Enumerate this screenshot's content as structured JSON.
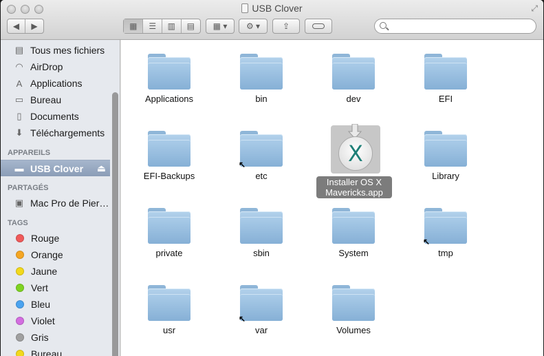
{
  "window": {
    "title": "USB Clover"
  },
  "toolbar": {
    "back_icon": "chevron-left-icon",
    "forward_icon": "chevron-right-icon",
    "view_modes": [
      "icon-view-icon",
      "list-view-icon",
      "column-view-icon",
      "coverflow-view-icon"
    ],
    "arrange_icon": "arrange-icon",
    "action_icon": "gear-icon",
    "share_icon": "share-icon",
    "tags_icon": "tag-icon",
    "search_placeholder": ""
  },
  "sidebar": {
    "favorites": [
      {
        "label": "Tous mes fichiers",
        "icon": "all-files-icon"
      },
      {
        "label": "AirDrop",
        "icon": "airdrop-icon"
      },
      {
        "label": "Applications",
        "icon": "applications-icon"
      },
      {
        "label": "Bureau",
        "icon": "desktop-icon"
      },
      {
        "label": "Documents",
        "icon": "documents-icon"
      },
      {
        "label": "Téléchargements",
        "icon": "downloads-icon"
      }
    ],
    "devices_header": "APPAREILS",
    "devices": [
      {
        "label": "USB Clover",
        "icon": "drive-icon",
        "eject": "⏏"
      }
    ],
    "shared_header": "PARTAGÉS",
    "shared": [
      {
        "label": "Mac Pro de Pier…",
        "icon": "computer-icon"
      }
    ],
    "tags_header": "TAGS",
    "tags": [
      {
        "label": "Rouge",
        "color": "#f05a5a"
      },
      {
        "label": "Orange",
        "color": "#f5a623"
      },
      {
        "label": "Jaune",
        "color": "#f2d91c"
      },
      {
        "label": "Vert",
        "color": "#7ed321"
      },
      {
        "label": "Bleu",
        "color": "#4aa3f0"
      },
      {
        "label": "Violet",
        "color": "#d36ee0"
      },
      {
        "label": "Gris",
        "color": "#a0a0a0"
      },
      {
        "label": "Bureau",
        "color": "#f2d91c"
      }
    ]
  },
  "files": [
    {
      "name": "Applications",
      "kind": "folder",
      "alias": false
    },
    {
      "name": "bin",
      "kind": "folder",
      "alias": false
    },
    {
      "name": "dev",
      "kind": "folder",
      "alias": false
    },
    {
      "name": "EFI",
      "kind": "folder",
      "alias": false
    },
    {
      "name": "EFI-Backups",
      "kind": "folder",
      "alias": false
    },
    {
      "name": "etc",
      "kind": "folder",
      "alias": true
    },
    {
      "name": "Installer OS X Mavericks.app",
      "kind": "app",
      "alias": false
    },
    {
      "name": "Library",
      "kind": "folder",
      "alias": false
    },
    {
      "name": "private",
      "kind": "folder",
      "alias": false
    },
    {
      "name": "sbin",
      "kind": "folder",
      "alias": false
    },
    {
      "name": "System",
      "kind": "folder",
      "alias": false
    },
    {
      "name": "tmp",
      "kind": "folder",
      "alias": true
    },
    {
      "name": "usr",
      "kind": "folder",
      "alias": false
    },
    {
      "name": "var",
      "kind": "folder",
      "alias": true
    },
    {
      "name": "Volumes",
      "kind": "folder",
      "alias": false
    }
  ],
  "app_icon_glyph": "X",
  "alias_glyph": "↖"
}
